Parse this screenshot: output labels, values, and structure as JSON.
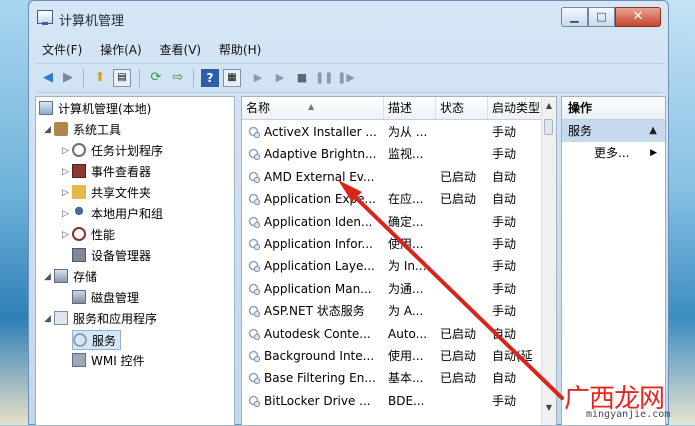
{
  "window": {
    "title": "计算机管理",
    "min": "▁",
    "max": "□",
    "close": "✕"
  },
  "menubar": [
    "文件(F)",
    "操作(A)",
    "查看(V)",
    "帮助(H)"
  ],
  "tree": {
    "root": "计算机管理(本地)",
    "system_tools": "系统工具",
    "task_scheduler": "任务计划程序",
    "event_viewer": "事件查看器",
    "shared_folders": "共享文件夹",
    "local_users": "本地用户和组",
    "performance": "性能",
    "device_manager": "设备管理器",
    "storage": "存储",
    "disk_mgmt": "磁盘管理",
    "services_apps": "服务和应用程序",
    "services": "服务",
    "wmi": "WMI 控件"
  },
  "services_table": {
    "headers": [
      "名称",
      "描述",
      "状态",
      "启动类型"
    ],
    "rows": [
      {
        "name": "ActiveX Installer ...",
        "desc": "为从 ...",
        "status": "",
        "startup": "手动"
      },
      {
        "name": "Adaptive Brightn...",
        "desc": "监视...",
        "status": "",
        "startup": "手动"
      },
      {
        "name": "AMD External Ev...",
        "desc": "",
        "status": "已启动",
        "startup": "自动"
      },
      {
        "name": "Application Expe...",
        "desc": "在应...",
        "status": "已启动",
        "startup": "自动"
      },
      {
        "name": "Application Iden...",
        "desc": "确定...",
        "status": "",
        "startup": "手动"
      },
      {
        "name": "Application Infor...",
        "desc": "使用...",
        "status": "",
        "startup": "手动"
      },
      {
        "name": "Application Laye...",
        "desc": "为 In...",
        "status": "",
        "startup": "手动"
      },
      {
        "name": "Application Man...",
        "desc": "为通...",
        "status": "",
        "startup": "手动"
      },
      {
        "name": "ASP.NET 状态服务",
        "desc": "为 A...",
        "status": "",
        "startup": "手动"
      },
      {
        "name": "Autodesk Conte...",
        "desc": "Auto...",
        "status": "已启动",
        "startup": "自动"
      },
      {
        "name": "Background Inte...",
        "desc": "使用...",
        "status": "已启动",
        "startup": "自动(延"
      },
      {
        "name": "Base Filtering En...",
        "desc": "基本...",
        "status": "已启动",
        "startup": "自动"
      },
      {
        "name": "BitLocker Drive ...",
        "desc": "BDE...",
        "status": "",
        "startup": "手动"
      }
    ]
  },
  "actions": {
    "header": "操作",
    "section": "服务",
    "more": "更多..."
  },
  "watermark": {
    "text": "广西龙网",
    "url": "mingyanjie.com"
  }
}
